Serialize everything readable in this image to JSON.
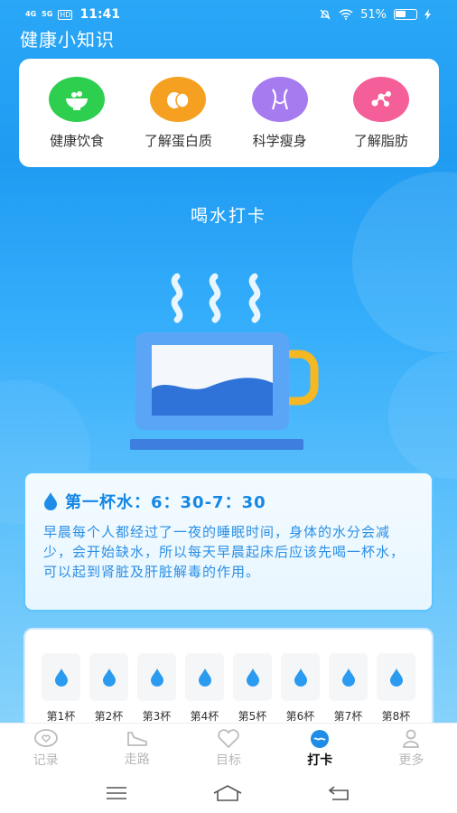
{
  "status": {
    "net1": "4G",
    "net2": "5G",
    "hd": "HD",
    "time": "11:41",
    "battery": "51%"
  },
  "app": {
    "title": "健康小知识"
  },
  "categories": [
    {
      "label": "健康饮食",
      "icon": "bowl-icon",
      "color": "#2ecf4f"
    },
    {
      "label": "了解蛋白质",
      "icon": "egg-icon",
      "color": "#f5a020"
    },
    {
      "label": "科学瘦身",
      "icon": "body-icon",
      "color": "#a77bf0"
    },
    {
      "label": "了解脂肪",
      "icon": "molecule-icon",
      "color": "#f45f9a"
    }
  ],
  "section": {
    "title": "喝水打卡"
  },
  "tip": {
    "title": "第一杯水：6：30-7：30",
    "body": "早晨每个人都经过了一夜的睡眠时间，身体的水分会减少，会开始缺水，所以每天早晨起床后应该先喝一杯水，可以起到肾脏及肝脏解毒的作用。"
  },
  "cups": [
    {
      "label": "第1杯"
    },
    {
      "label": "第2杯"
    },
    {
      "label": "第3杯"
    },
    {
      "label": "第4杯"
    },
    {
      "label": "第5杯"
    },
    {
      "label": "第6杯"
    },
    {
      "label": "第7杯"
    },
    {
      "label": "第8杯"
    }
  ],
  "tabs": [
    {
      "label": "记录",
      "icon": "heart-chat-icon",
      "active": false
    },
    {
      "label": "走路",
      "icon": "shoe-icon",
      "active": false
    },
    {
      "label": "目标",
      "icon": "heart-icon",
      "active": false
    },
    {
      "label": "打卡",
      "icon": "water-drop-icon",
      "active": true
    },
    {
      "label": "更多",
      "icon": "person-icon",
      "active": false
    }
  ],
  "colors": {
    "primary": "#1f9bf2",
    "accent_text": "#1587e4",
    "drop": "#2b9bf0"
  }
}
